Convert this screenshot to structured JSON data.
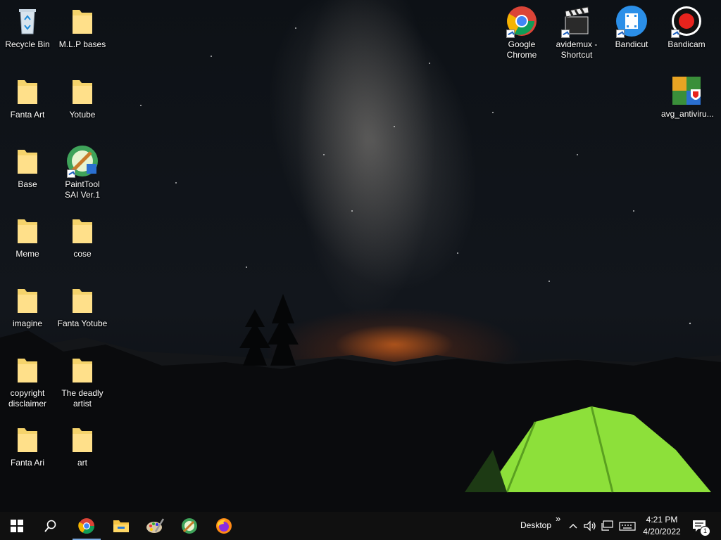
{
  "desktop_icons": {
    "recycle_bin": "Recycle Bin",
    "mlp_bases": "M.L.P bases",
    "fanta_art": "Fanta Art",
    "yotube": "Yotube",
    "base": "Base",
    "painttool_sai": "PaintTool SAI Ver.1",
    "meme": "Meme",
    "cose": "cose",
    "imagine": "imagine",
    "fanta_yotube": "Fanta Yotube",
    "copyright_disclaimer": "copyright disclaimer",
    "the_deadly_artist": "The deadly artist",
    "fanta_ari": "Fanta Ari",
    "art": "art",
    "google_chrome": "Google Chrome",
    "avidemux": "avidemux - Shortcut",
    "bandicut": "Bandicut",
    "bandicam": "Bandicam",
    "avg_antivirus": "avg_antiviru..."
  },
  "taskbar": {
    "desktop_label": "Desktop",
    "overflow_chevron": "»",
    "time": "4:21 PM",
    "date": "4/20/2022",
    "notification_count": "1"
  },
  "colors": {
    "folder_yellow": "#f5d36b",
    "taskbar": "#101010",
    "tent_green": "#8de03a",
    "horizon_orange": "#ff7a1e"
  }
}
